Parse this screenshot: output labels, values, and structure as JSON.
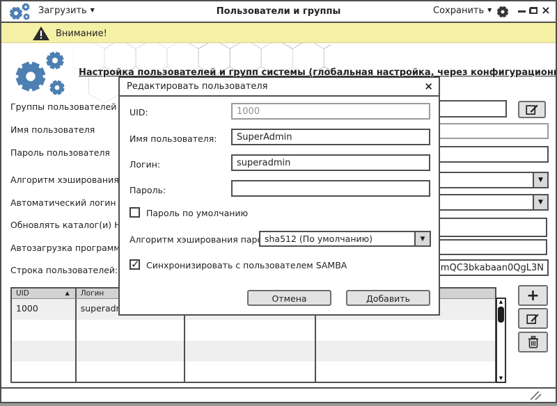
{
  "titlebar": {
    "load_label": "Загрузить",
    "title": "Пользователи и группы",
    "save_label": "Сохранить"
  },
  "warning_bar": {
    "text": "Внимание!"
  },
  "header": {
    "heading": "Настройка пользователей и групп системы (глобальная настройка, через конфигурационный файл)"
  },
  "main_form": {
    "labels": [
      "Группы пользователей (по",
      "Имя пользователя",
      "Пароль пользователя",
      "Алгоритм хэширования пар",
      "Автоматический логин пол",
      "Обновлять каталог(и) HOM",
      "Автозагрузка программ по",
      "Строка пользователей:"
    ],
    "users_string_value": "6HmQC3bkabaan0QgL3N"
  },
  "table": {
    "columns": [
      "UID",
      "Логин",
      "",
      ""
    ],
    "sorted_column": 0,
    "rows": [
      [
        "1000",
        "superadmin",
        "",
        ""
      ],
      [
        "",
        "",
        "",
        ""
      ],
      [
        "",
        "",
        "",
        ""
      ],
      [
        "",
        "",
        "",
        ""
      ],
      [
        "",
        "",
        "",
        ""
      ]
    ]
  },
  "dialog": {
    "title": "Редактировать пользователя",
    "uid_label": "UID:",
    "uid_value": "1000",
    "name_label": "Имя пользователя:",
    "name_value": "SuperAdmin",
    "login_label": "Логин:",
    "login_value": "superadmin",
    "password_label": "Пароль:",
    "password_value": "",
    "default_password_checkbox": {
      "label": "Пароль по умолчанию",
      "checked": false
    },
    "hash_label": "Алгоритм хэширования пароля:",
    "hash_value": "sha512 (По умолчанию)",
    "samba_checkbox": {
      "label": "Синхронизировать с пользователем SAMBA",
      "checked": true
    },
    "cancel_button": "Отмена",
    "add_button": "Добавить"
  },
  "icons": {
    "menu_caret": "▼",
    "dropdown": "▼",
    "close": "×",
    "sort_asc": "▲",
    "scroll_up": "▲",
    "scroll_down": "▼",
    "add": "+",
    "checkbox_check": "✓",
    "app_logo": "gears-logo",
    "settings": "gear-icon",
    "warning": "warning-triangle",
    "edit": "pencil-square",
    "delete": "trash-can"
  },
  "colors": {
    "accent_blue": "#4d7fb2",
    "warning_bg": "#f4f0a6",
    "border_dark": "#4f4f4f",
    "button_gray": "#e2e2e2",
    "table_header": "#d2d2d2",
    "row_alt": "#efefef"
  }
}
